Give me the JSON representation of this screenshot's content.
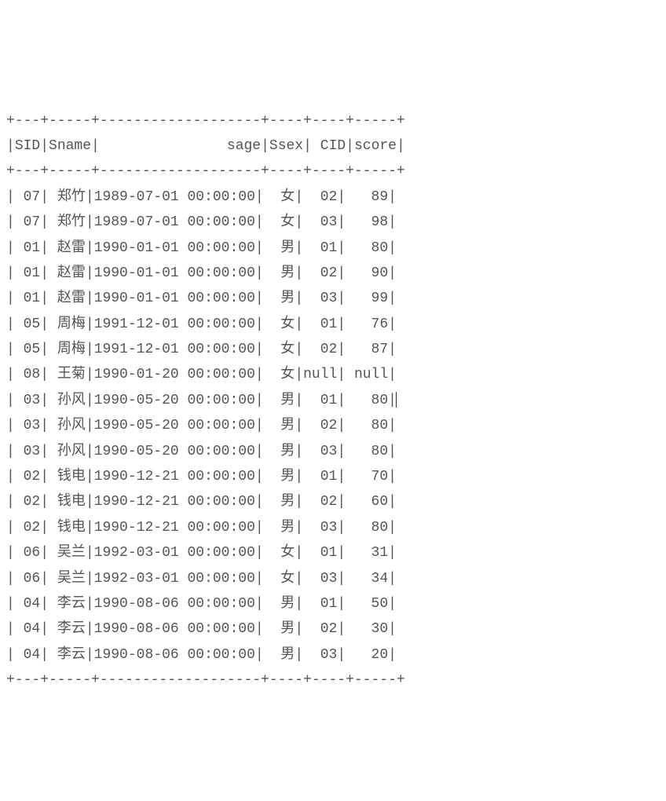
{
  "columns": [
    {
      "name": "SID",
      "width": 3,
      "align": "right"
    },
    {
      "name": "Sname",
      "width": 5,
      "align": "right"
    },
    {
      "name": "sage",
      "width": 19,
      "align": "right"
    },
    {
      "name": "Ssex",
      "width": 4,
      "align": "right"
    },
    {
      "name": "CID",
      "width": 4,
      "align": "right"
    },
    {
      "name": "score",
      "width": 5,
      "align": "right"
    }
  ],
  "cursor_row_index": 8,
  "rows": [
    {
      "SID": "07",
      "Sname": "郑竹",
      "sage": "1989-07-01 00:00:00",
      "Ssex": "女",
      "CID": "02",
      "score": "89"
    },
    {
      "SID": "07",
      "Sname": "郑竹",
      "sage": "1989-07-01 00:00:00",
      "Ssex": "女",
      "CID": "03",
      "score": "98"
    },
    {
      "SID": "01",
      "Sname": "赵雷",
      "sage": "1990-01-01 00:00:00",
      "Ssex": "男",
      "CID": "01",
      "score": "80"
    },
    {
      "SID": "01",
      "Sname": "赵雷",
      "sage": "1990-01-01 00:00:00",
      "Ssex": "男",
      "CID": "02",
      "score": "90"
    },
    {
      "SID": "01",
      "Sname": "赵雷",
      "sage": "1990-01-01 00:00:00",
      "Ssex": "男",
      "CID": "03",
      "score": "99"
    },
    {
      "SID": "05",
      "Sname": "周梅",
      "sage": "1991-12-01 00:00:00",
      "Ssex": "女",
      "CID": "01",
      "score": "76"
    },
    {
      "SID": "05",
      "Sname": "周梅",
      "sage": "1991-12-01 00:00:00",
      "Ssex": "女",
      "CID": "02",
      "score": "87"
    },
    {
      "SID": "08",
      "Sname": "王菊",
      "sage": "1990-01-20 00:00:00",
      "Ssex": "女",
      "CID": "null",
      "score": "null"
    },
    {
      "SID": "03",
      "Sname": "孙风",
      "sage": "1990-05-20 00:00:00",
      "Ssex": "男",
      "CID": "01",
      "score": "80"
    },
    {
      "SID": "03",
      "Sname": "孙风",
      "sage": "1990-05-20 00:00:00",
      "Ssex": "男",
      "CID": "02",
      "score": "80"
    },
    {
      "SID": "03",
      "Sname": "孙风",
      "sage": "1990-05-20 00:00:00",
      "Ssex": "男",
      "CID": "03",
      "score": "80"
    },
    {
      "SID": "02",
      "Sname": "钱电",
      "sage": "1990-12-21 00:00:00",
      "Ssex": "男",
      "CID": "01",
      "score": "70"
    },
    {
      "SID": "02",
      "Sname": "钱电",
      "sage": "1990-12-21 00:00:00",
      "Ssex": "男",
      "CID": "02",
      "score": "60"
    },
    {
      "SID": "02",
      "Sname": "钱电",
      "sage": "1990-12-21 00:00:00",
      "Ssex": "男",
      "CID": "03",
      "score": "80"
    },
    {
      "SID": "06",
      "Sname": "吴兰",
      "sage": "1992-03-01 00:00:00",
      "Ssex": "女",
      "CID": "01",
      "score": "31"
    },
    {
      "SID": "06",
      "Sname": "吴兰",
      "sage": "1992-03-01 00:00:00",
      "Ssex": "女",
      "CID": "03",
      "score": "34"
    },
    {
      "SID": "04",
      "Sname": "李云",
      "sage": "1990-08-06 00:00:00",
      "Ssex": "男",
      "CID": "01",
      "score": "50"
    },
    {
      "SID": "04",
      "Sname": "李云",
      "sage": "1990-08-06 00:00:00",
      "Ssex": "男",
      "CID": "02",
      "score": "30"
    },
    {
      "SID": "04",
      "Sname": "李云",
      "sage": "1990-08-06 00:00:00",
      "Ssex": "男",
      "CID": "03",
      "score": "20"
    }
  ]
}
